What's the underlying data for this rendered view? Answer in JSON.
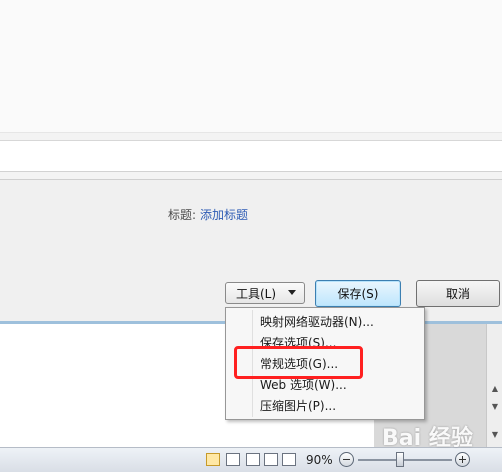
{
  "dialog": {
    "title_label": "标题:",
    "title_link": "添加标题"
  },
  "buttons": {
    "tools": "工具(L)",
    "save": "保存(S)",
    "cancel": "取消"
  },
  "tools_menu": {
    "items": [
      "映射网络驱动器(N)...",
      "保存选项(S)...",
      "常规选项(G)...",
      "Web 选项(W)...",
      "压缩图片(P)..."
    ],
    "highlighted_index": 2,
    "highlight_color": "#ff2020"
  },
  "status": {
    "zoom": "90%",
    "zoom_level": 0.9
  },
  "watermark": {
    "text": "Bai 经验"
  }
}
